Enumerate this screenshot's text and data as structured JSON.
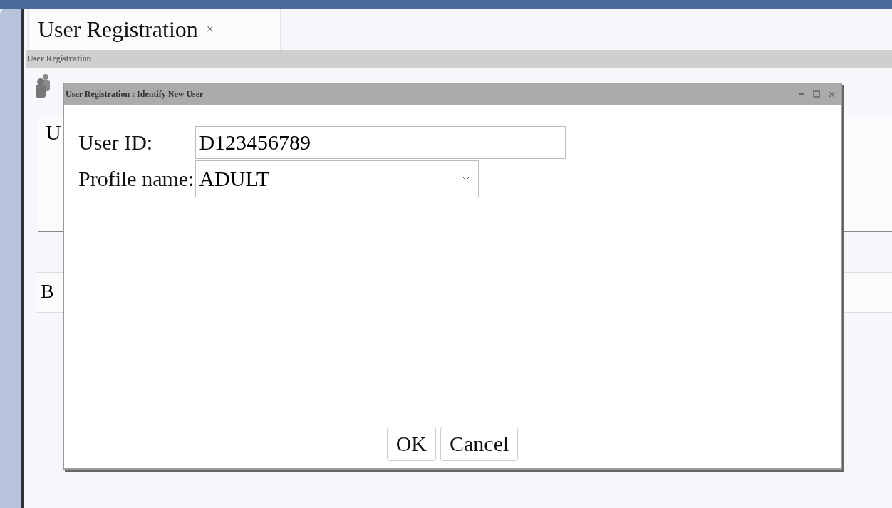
{
  "tab": {
    "label": "User Registration",
    "close": "×",
    "selected": true
  },
  "section_bar": {
    "title": "User Registration"
  },
  "background": {
    "panel_1_text": "U",
    "panel_2_text": "B"
  },
  "dialog": {
    "title": "User Registration : Identify New User",
    "fields": [
      {
        "kind": "text",
        "label": "User ID:",
        "value": "D123456789"
      },
      {
        "kind": "select",
        "label": "Profile name:",
        "value": "ADULT"
      }
    ],
    "buttons": [
      "OK",
      "Cancel"
    ]
  }
}
